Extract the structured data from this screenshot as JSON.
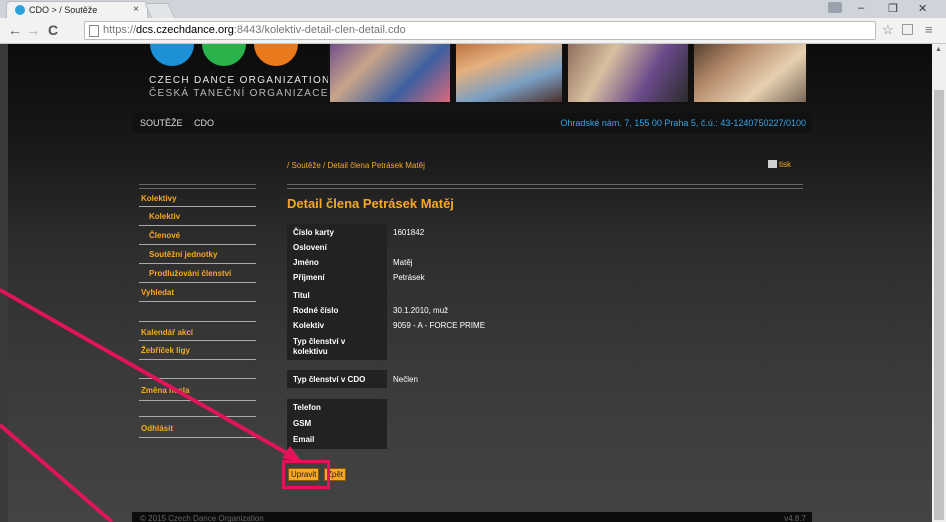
{
  "browser": {
    "tab_title": "CDO > / Soutěže",
    "tab_close": "×",
    "url_scheme": "https://",
    "url_host": "dcs.czechdance.org",
    "url_rest": ":8443/kolektiv-detail-clen-detail.cdo",
    "win_minimize": "–",
    "win_maximize": "❐",
    "win_close": "✕",
    "back": "←",
    "forward": "→",
    "reload": "C",
    "star": "☆",
    "menu": "≡"
  },
  "brand": {
    "line1": "CZECH DANCE ORGANIZATION",
    "line2": "ČESKÁ TANEČNÍ ORGANIZACE",
    "colors": [
      "#1e90d6",
      "#2ab34a",
      "#e87a1c"
    ]
  },
  "nav": {
    "items": [
      "SOUTĚŽE",
      "CDO"
    ],
    "address": "Ohradské nám. 7, 155 00 Praha 5, č.ú.: 43-1240750227/0100"
  },
  "breadcrumb": "/ Soutěže / Detail člena Petrásek Matěj",
  "print_label": "tisk",
  "sidebar": {
    "items": [
      {
        "label": "Kolektivy"
      },
      {
        "label": "Kolektiv"
      },
      {
        "label": "Členové"
      },
      {
        "label": "Soutěžní jednotky"
      },
      {
        "label": "Prodlužování členství"
      },
      {
        "label": "Vyhledat"
      },
      {
        "label": "Kalendář akcí"
      },
      {
        "label": "Žebříček ligy"
      },
      {
        "label": "Změna hesla"
      },
      {
        "label": "Odhlásit"
      }
    ]
  },
  "detail": {
    "title": "Detail člena Petrásek Matěj",
    "fields": [
      {
        "label": "Číslo karty",
        "value": "1601842"
      },
      {
        "label": "Oslovení",
        "value": ""
      },
      {
        "label": "Jméno",
        "value": "Matěj"
      },
      {
        "label": "Příjmení",
        "value": "Petrásek"
      },
      {
        "label": "Titul",
        "value": ""
      },
      {
        "label": "Rodné číslo",
        "value": "30.1.2010, muž"
      },
      {
        "label": "Kolektiv",
        "value": "9059 - A - FORCE PRIME"
      },
      {
        "label": "Typ členství v kolektivu",
        "value": ""
      }
    ],
    "cdo_type": {
      "label": "Typ členství v CDO",
      "value": "Nečlen"
    },
    "contacts": [
      {
        "label": "Telefon",
        "value": ""
      },
      {
        "label": "GSM",
        "value": ""
      },
      {
        "label": "Email",
        "value": ""
      }
    ]
  },
  "buttons": {
    "edit": "Upravit",
    "back": "Zpět"
  },
  "footer": {
    "copyright": "© 2015 Czech Dance Organization",
    "version": "v4.8.7"
  },
  "accent": "#f7a823",
  "annotation_color": "#e0145a"
}
